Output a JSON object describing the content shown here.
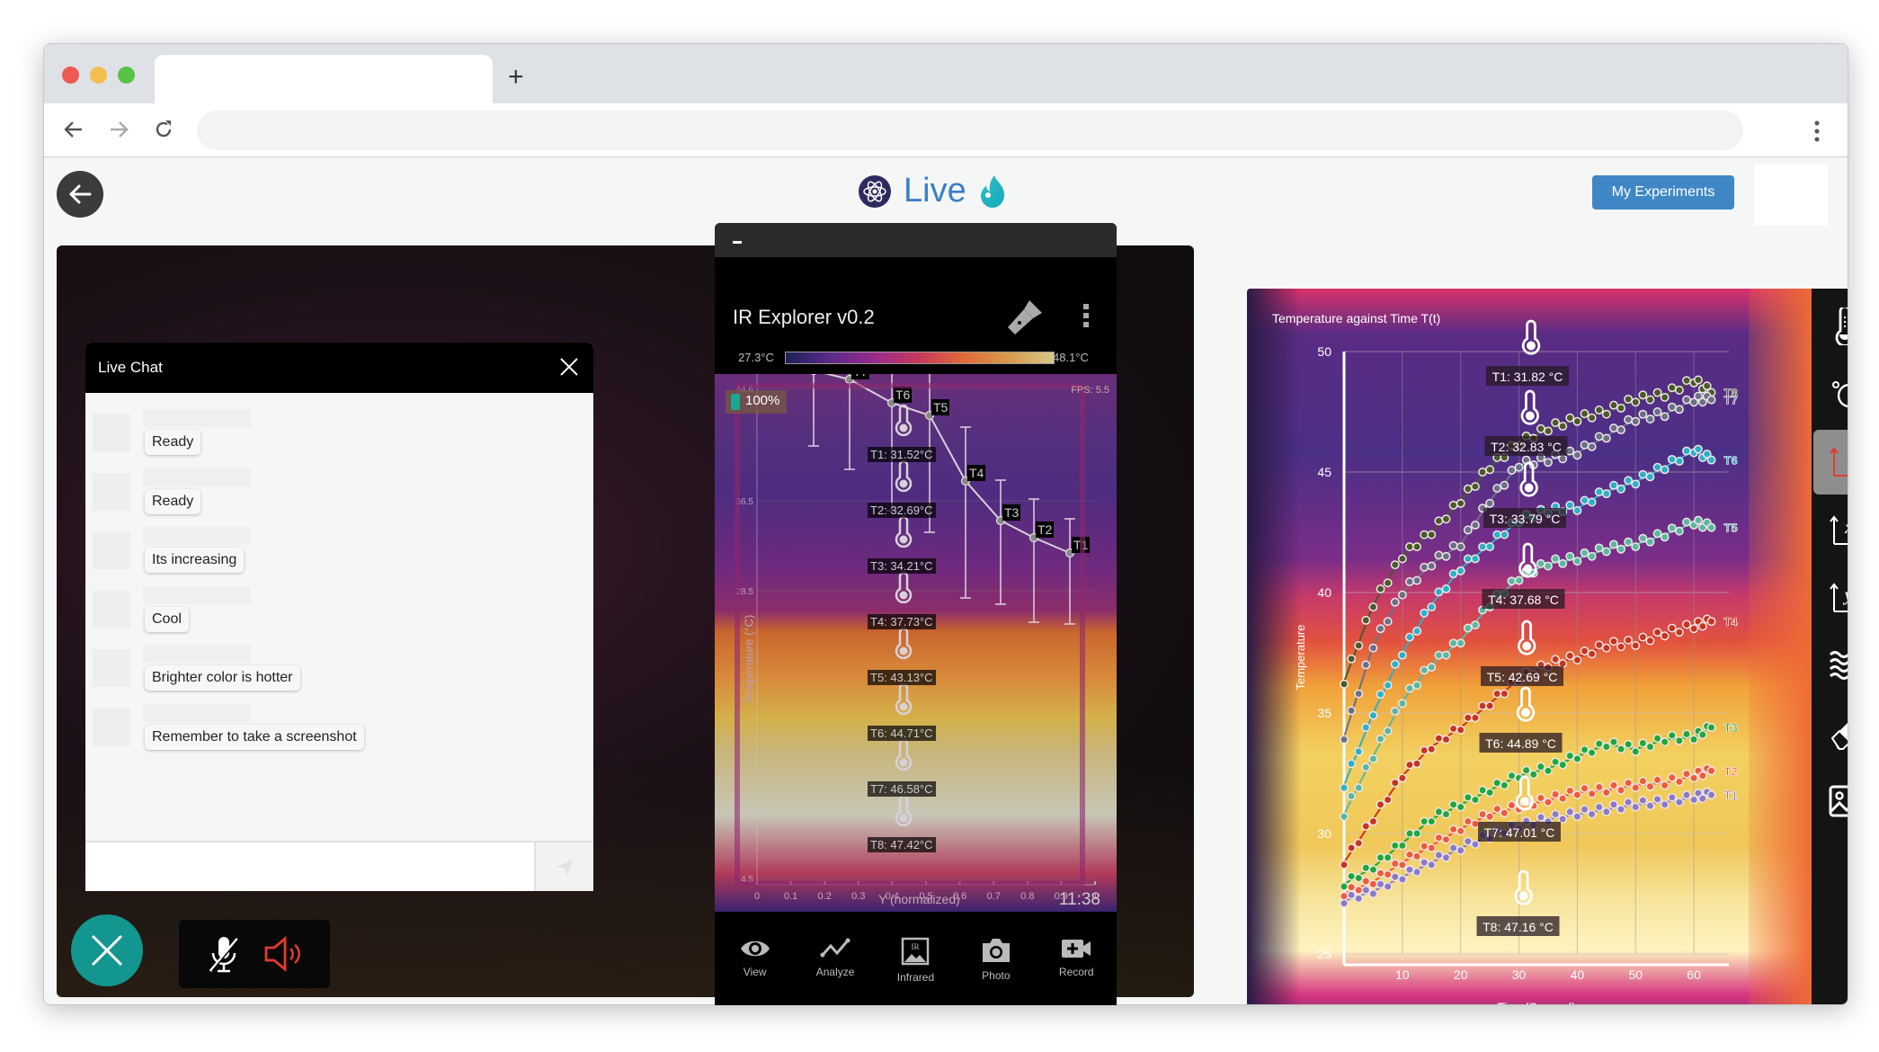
{
  "browser": {
    "tab_title": "",
    "new_tab_label": "+",
    "address": "",
    "back_icon": "arrow-left-icon",
    "forward_icon": "arrow-right-icon",
    "reload_icon": "reload-icon",
    "menu_icon": "kebab-menu-icon"
  },
  "app_header": {
    "title": "Live",
    "logo_icon": "atom-icon",
    "flame_icon": "flame-icon",
    "my_experiments_label": "My Experiments",
    "accent": "#3a7fc8",
    "button_color": "#3f88c5"
  },
  "chat": {
    "title": "Live Chat",
    "messages": [
      {
        "sender": "",
        "text": "Ready"
      },
      {
        "sender": "",
        "text": "Ready"
      },
      {
        "sender": "",
        "text": "Its increasing"
      },
      {
        "sender": "",
        "text": "Cool"
      },
      {
        "sender": "",
        "text": "Brighter color is hotter"
      },
      {
        "sender": "",
        "text": "Remember to take a screenshot"
      }
    ],
    "input_value": "",
    "input_placeholder": "",
    "send_icon": "send-icon"
  },
  "call_controls": {
    "end_call_icon": "close-icon",
    "end_call_color": "#12968f",
    "mic_icon": "mic-muted-icon",
    "speaker_icon": "speaker-icon",
    "speaker_color": "#e23b2e"
  },
  "phone_app": {
    "title": "IR Explorer v0.2",
    "scale_min": "27.3°C",
    "scale_max": "48.1°C",
    "battery": "100%",
    "fps": "FPS: 5.5",
    "clock": "11:38",
    "y_axis_label": "Temperature (°C)",
    "x_axis_label": "Y (normalized)",
    "y_ticks": [
      "44.6",
      "36.5",
      "28.5",
      "4.5"
    ],
    "x_ticks": [
      "0",
      "0.1",
      "0.2",
      "0.3",
      "0.4",
      "0.5",
      "0.6",
      "0.7",
      "0.8",
      "0.9",
      "1"
    ],
    "probes": [
      {
        "name": "T1",
        "label": "T1: 31.52°C"
      },
      {
        "name": "T2",
        "label": "T2: 32.69°C"
      },
      {
        "name": "T3",
        "label": "T3: 34.21°C"
      },
      {
        "name": "T4",
        "label": "T4: 37.73°C"
      },
      {
        "name": "T5",
        "label": "T5: 43.13°C"
      },
      {
        "name": "T6",
        "label": "T6: 44.71°C"
      },
      {
        "name": "T7",
        "label": "T7: 46.58°C"
      },
      {
        "name": "T8",
        "label": "T8: 47.42°C"
      }
    ],
    "nav": [
      {
        "label": "View",
        "icon": "eye-icon"
      },
      {
        "label": "Analyze",
        "icon": "line-chart-icon"
      },
      {
        "label": "Infrared",
        "icon": "infrared-image-icon"
      },
      {
        "label": "Photo",
        "icon": "camera-icon"
      },
      {
        "label": "Record",
        "icon": "video-add-icon"
      }
    ]
  },
  "profile_chart": {
    "type": "line",
    "points": [
      {
        "name": "T8",
        "x": 0.0,
        "y": 46.8
      },
      {
        "name": "T7",
        "x": 0.1,
        "y": 46.4
      },
      {
        "name": "T6",
        "x": 0.2,
        "y": 45.5
      },
      {
        "name": "T5",
        "x": 0.33,
        "y": 44.7
      },
      {
        "name": "T4",
        "x": 0.44,
        "y": 41.4
      },
      {
        "name": "T3",
        "x": 0.54,
        "y": 39.5
      },
      {
        "name": "T2",
        "x": 0.64,
        "y": 38.7
      },
      {
        "name": "T1",
        "x": 0.74,
        "y": 38.1
      }
    ]
  },
  "probe_overlay": {
    "labels": [
      "T1: 31.82 °C",
      "T2: 32.83 °C",
      "T3: 33.79 °C",
      "T4: 37.68 °C",
      "T5: 42.69 °C",
      "T6: 44.89 °C",
      "T7: 47.01 °C",
      "T8: 47.16 °C"
    ]
  },
  "chart_data": {
    "type": "line",
    "title": "Temperature against Time T(t)",
    "xlabel": "Time(Second)",
    "ylabel": "Temperature",
    "xlim": [
      0,
      66
    ],
    "ylim": [
      25,
      50
    ],
    "x_ticks": [
      10,
      20,
      30,
      40,
      50,
      60
    ],
    "y_ticks": [
      25,
      30,
      35,
      40,
      45,
      50
    ],
    "grid": true,
    "legend": "inline-right",
    "x": [
      0,
      5,
      10,
      15,
      20,
      25,
      30,
      35,
      40,
      45,
      50,
      55,
      60,
      63
    ],
    "series": [
      {
        "name": "T8",
        "color": "#4a5a2a",
        "values": [
          36.3,
          39.5,
          41.5,
          42.5,
          43.8,
          45.2,
          46.2,
          46.8,
          47.2,
          47.5,
          48.0,
          48.2,
          48.8,
          48.3
        ]
      },
      {
        "name": "T7",
        "color": "#6a7088",
        "values": [
          34.0,
          37.8,
          40.0,
          41.2,
          42.0,
          43.8,
          45.3,
          45.5,
          45.8,
          46.5,
          47.2,
          47.4,
          48.0,
          48.0
        ]
      },
      {
        "name": "T6",
        "color": "#2cb0c8",
        "values": [
          32.0,
          35.0,
          37.5,
          39.5,
          41.0,
          42.0,
          43.0,
          43.4,
          43.5,
          44.2,
          44.6,
          45.2,
          45.9,
          45.5
        ]
      },
      {
        "name": "T5",
        "color": "#5ab8a0",
        "values": [
          30.8,
          33.2,
          35.5,
          37.0,
          38.0,
          39.5,
          40.6,
          41.2,
          41.4,
          41.8,
          42.0,
          42.4,
          42.9,
          42.7
        ]
      },
      {
        "name": "T4",
        "color": "#c8341e",
        "values": [
          28.8,
          30.6,
          32.4,
          33.6,
          34.4,
          35.4,
          36.4,
          37.0,
          37.3,
          37.8,
          37.9,
          38.3,
          38.6,
          38.8
        ]
      },
      {
        "name": "T3",
        "color": "#1fa83a",
        "values": [
          27.9,
          28.6,
          29.6,
          30.6,
          31.2,
          31.8,
          32.4,
          32.7,
          33.2,
          33.7,
          33.5,
          33.9,
          34.0,
          34.4
        ]
      },
      {
        "name": "T2",
        "color": "#f05a3a",
        "values": [
          27.5,
          28.0,
          28.8,
          29.5,
          30.2,
          30.8,
          31.1,
          31.4,
          31.7,
          31.8,
          32.0,
          32.1,
          32.4,
          32.6
        ]
      },
      {
        "name": "T1",
        "color": "#8a7ac8",
        "values": [
          27.2,
          27.6,
          28.2,
          28.8,
          29.4,
          29.9,
          30.3,
          30.6,
          30.8,
          31.0,
          31.2,
          31.3,
          31.5,
          31.6
        ]
      }
    ]
  },
  "right_toolbar": {
    "tools": [
      {
        "name": "thermometer",
        "icon": "thermometer-icon",
        "active": false
      },
      {
        "name": "celsius",
        "icon": "celsius-icon",
        "active": false
      },
      {
        "name": "temperature-vs-time",
        "icon": "t-axis-icon",
        "active": true
      },
      {
        "name": "temperature-vs-x",
        "icon": "x-axis-icon",
        "active": false
      },
      {
        "name": "temperature-vs-y",
        "icon": "y-axis-icon",
        "active": false
      },
      {
        "name": "heat-waves",
        "icon": "heat-waves-icon",
        "active": false
      },
      {
        "name": "eraser",
        "icon": "eraser-icon",
        "active": false
      },
      {
        "name": "image",
        "icon": "image-icon",
        "active": false
      }
    ],
    "active_color": "#e23b2e"
  }
}
